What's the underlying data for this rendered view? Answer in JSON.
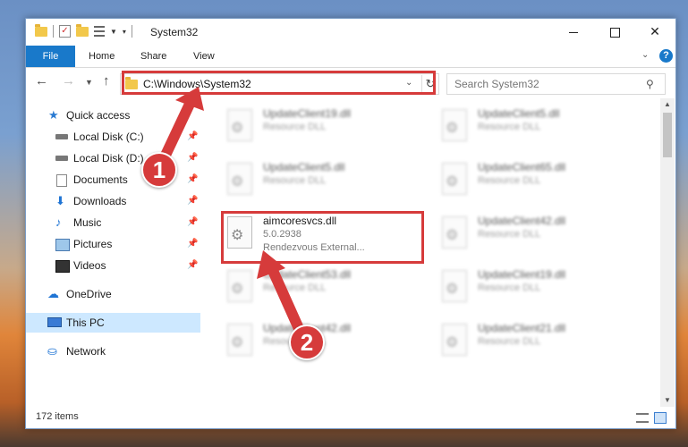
{
  "window": {
    "title": "System32",
    "controls": {
      "minimize": "",
      "maximize": "",
      "close": "✕"
    }
  },
  "ribbon": {
    "tabs": [
      "File",
      "Home",
      "Share",
      "View"
    ],
    "help": "?"
  },
  "nav": {
    "address": "C:\\Windows\\System32",
    "search_placeholder": "Search System32"
  },
  "sidebar": {
    "items": [
      {
        "label": "Quick access",
        "icon": "star-icon"
      },
      {
        "label": "Local Disk (C:)",
        "icon": "disk-icon",
        "pinned": true
      },
      {
        "label": "Local Disk (D:)",
        "icon": "disk-icon",
        "pinned": true
      },
      {
        "label": "Documents",
        "icon": "documents-icon",
        "pinned": true
      },
      {
        "label": "Downloads",
        "icon": "download-icon",
        "pinned": true
      },
      {
        "label": "Music",
        "icon": "music-icon",
        "pinned": true
      },
      {
        "label": "Pictures",
        "icon": "pictures-icon",
        "pinned": true
      },
      {
        "label": "Videos",
        "icon": "videos-icon",
        "pinned": true
      },
      {
        "label": "OneDrive",
        "icon": "cloud-icon"
      },
      {
        "label": "This PC",
        "icon": "computer-icon",
        "selected": true
      },
      {
        "label": "Network",
        "icon": "network-icon"
      }
    ]
  },
  "files": [
    {
      "name": "UpdateClient19.dll",
      "line2": "Resource DLL"
    },
    {
      "name": "UpdateClient5.dll",
      "line2": "Resource DLL"
    },
    {
      "name": "UpdateClient5.dll",
      "line2": "Resource DLL"
    },
    {
      "name": "UpdateClient65.dll",
      "line2": "Resource DLL"
    },
    {
      "name": "aimcoresvcs.dll",
      "line2": "5.0.2938",
      "line3": "Rendezvous External..."
    },
    {
      "name": "UpdateClient42.dll",
      "line2": "Resource DLL"
    },
    {
      "name": "UpdateClient53.dll",
      "line2": "Resource DLL"
    },
    {
      "name": "UpdateClient19.dll",
      "line2": "Resource DLL"
    },
    {
      "name": "UpdateClient42.dll",
      "line2": "Resource DLL"
    },
    {
      "name": "UpdateClient21.dll",
      "line2": "Resource DLL"
    }
  ],
  "status": {
    "item_count": "172 items"
  },
  "callouts": [
    "1",
    "2"
  ],
  "colors": {
    "accent": "#1979ca",
    "highlight": "#d63b3b",
    "selection": "#cde8ff"
  }
}
